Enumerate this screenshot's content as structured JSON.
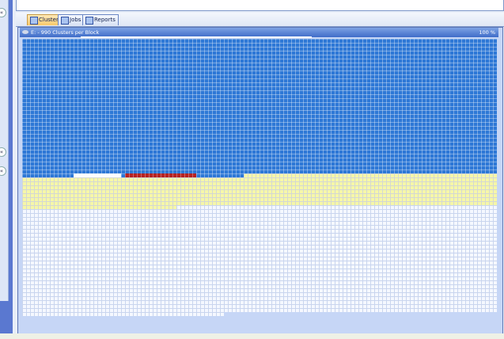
{
  "tabs": [
    {
      "label": "Clusters",
      "icon": "clusters-icon",
      "active": true
    },
    {
      "label": "Jobs",
      "icon": "jobs-icon"
    },
    {
      "label": "Reports",
      "icon": "reports-icon"
    }
  ],
  "panel": {
    "title": "E: - 990 Clusters per Block",
    "percent": "100 %",
    "progress": 0.5
  },
  "cluster_map": {
    "columns": 120,
    "runs": [
      [
        "used",
        4093
      ],
      [
        "free",
        12
      ],
      [
        "used",
        1
      ],
      [
        "frag",
        18
      ],
      [
        "used",
        12
      ],
      [
        "unmoved",
        943
      ],
      [
        "empty",
        3252
      ]
    ]
  },
  "colors": {
    "used": "#2e78d6",
    "frag": "#b52222",
    "unmoved": "#f6f7a8",
    "empty": "#f5f8ff"
  }
}
